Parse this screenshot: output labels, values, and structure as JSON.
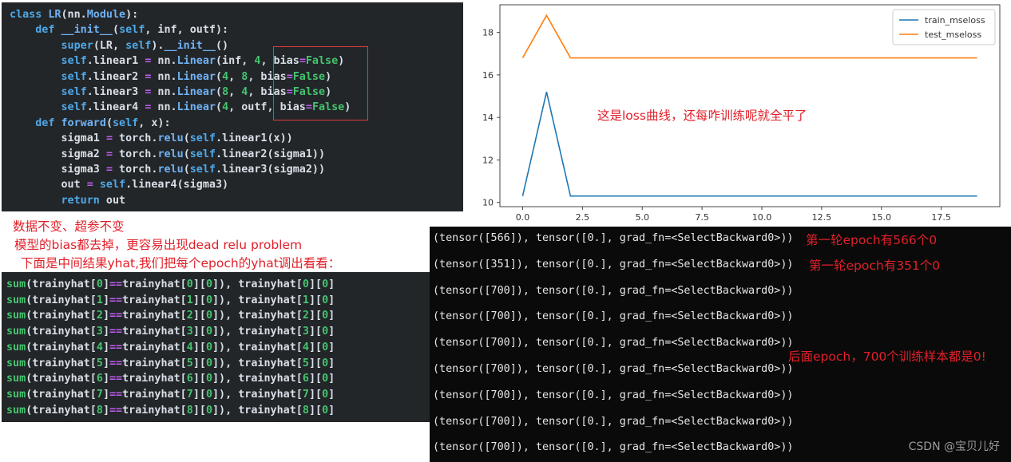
{
  "code": {
    "lines": [
      [
        {
          "t": "class ",
          "c": "kw"
        },
        {
          "t": "LR",
          "c": "fn"
        },
        {
          "t": "(nn.",
          "c": "name"
        },
        {
          "t": "Module",
          "c": "fn"
        },
        {
          "t": "):",
          "c": "name"
        }
      ],
      [
        {
          "t": "    def ",
          "c": "kw"
        },
        {
          "t": "__init__",
          "c": "fn"
        },
        {
          "t": "(",
          "c": "name"
        },
        {
          "t": "self",
          "c": "kw"
        },
        {
          "t": ", inf, outf):",
          "c": "name"
        }
      ],
      [
        {
          "t": "        ",
          "c": "name"
        },
        {
          "t": "super",
          "c": "kw"
        },
        {
          "t": "(LR, ",
          "c": "name"
        },
        {
          "t": "self",
          "c": "kw"
        },
        {
          "t": ").",
          "c": "name"
        },
        {
          "t": "__init__",
          "c": "fn"
        },
        {
          "t": "()",
          "c": "name"
        }
      ],
      [
        {
          "t": "        ",
          "c": "name"
        },
        {
          "t": "self",
          "c": "kw"
        },
        {
          "t": ".linear1 ",
          "c": "name"
        },
        {
          "t": "=",
          "c": "pur"
        },
        {
          "t": " nn.",
          "c": "name"
        },
        {
          "t": "Linear",
          "c": "fn"
        },
        {
          "t": "(inf, ",
          "c": "name"
        },
        {
          "t": "4",
          "c": "grn"
        },
        {
          "t": ", bias",
          "c": "name"
        },
        {
          "t": "=",
          "c": "pur"
        },
        {
          "t": "False",
          "c": "grn"
        },
        {
          "t": ")",
          "c": "name"
        }
      ],
      [
        {
          "t": "        ",
          "c": "name"
        },
        {
          "t": "self",
          "c": "kw"
        },
        {
          "t": ".linear2 ",
          "c": "name"
        },
        {
          "t": "=",
          "c": "pur"
        },
        {
          "t": " nn.",
          "c": "name"
        },
        {
          "t": "Linear",
          "c": "fn"
        },
        {
          "t": "(",
          "c": "name"
        },
        {
          "t": "4",
          "c": "grn"
        },
        {
          "t": ", ",
          "c": "name"
        },
        {
          "t": "8",
          "c": "grn"
        },
        {
          "t": ", bias",
          "c": "name"
        },
        {
          "t": "=",
          "c": "pur"
        },
        {
          "t": "False",
          "c": "grn"
        },
        {
          "t": ")",
          "c": "name"
        }
      ],
      [
        {
          "t": "        ",
          "c": "name"
        },
        {
          "t": "self",
          "c": "kw"
        },
        {
          "t": ".linear3 ",
          "c": "name"
        },
        {
          "t": "=",
          "c": "pur"
        },
        {
          "t": " nn.",
          "c": "name"
        },
        {
          "t": "Linear",
          "c": "fn"
        },
        {
          "t": "(",
          "c": "name"
        },
        {
          "t": "8",
          "c": "grn"
        },
        {
          "t": ", ",
          "c": "name"
        },
        {
          "t": "4",
          "c": "grn"
        },
        {
          "t": ", bias",
          "c": "name"
        },
        {
          "t": "=",
          "c": "pur"
        },
        {
          "t": "False",
          "c": "grn"
        },
        {
          "t": ")",
          "c": "name"
        }
      ],
      [
        {
          "t": "        ",
          "c": "name"
        },
        {
          "t": "self",
          "c": "kw"
        },
        {
          "t": ".linear4 ",
          "c": "name"
        },
        {
          "t": "=",
          "c": "pur"
        },
        {
          "t": " nn.",
          "c": "name"
        },
        {
          "t": "Linear",
          "c": "fn"
        },
        {
          "t": "(",
          "c": "name"
        },
        {
          "t": "4",
          "c": "grn"
        },
        {
          "t": ", outf, bias",
          "c": "name"
        },
        {
          "t": "=",
          "c": "pur"
        },
        {
          "t": "False",
          "c": "grn"
        },
        {
          "t": ")",
          "c": "name"
        }
      ],
      [
        {
          "t": "    def ",
          "c": "kw"
        },
        {
          "t": "forward",
          "c": "fn"
        },
        {
          "t": "(",
          "c": "name"
        },
        {
          "t": "self",
          "c": "kw"
        },
        {
          "t": ", x):",
          "c": "name"
        }
      ],
      [
        {
          "t": "        sigma1 ",
          "c": "name"
        },
        {
          "t": "=",
          "c": "pur"
        },
        {
          "t": " torch.",
          "c": "name"
        },
        {
          "t": "relu",
          "c": "fn"
        },
        {
          "t": "(",
          "c": "name"
        },
        {
          "t": "self",
          "c": "kw"
        },
        {
          "t": ".linear1(x))",
          "c": "name"
        }
      ],
      [
        {
          "t": "        sigma2 ",
          "c": "name"
        },
        {
          "t": "=",
          "c": "pur"
        },
        {
          "t": " torch.",
          "c": "name"
        },
        {
          "t": "relu",
          "c": "fn"
        },
        {
          "t": "(",
          "c": "name"
        },
        {
          "t": "self",
          "c": "kw"
        },
        {
          "t": ".linear2(sigma1))",
          "c": "name"
        }
      ],
      [
        {
          "t": "        sigma3 ",
          "c": "name"
        },
        {
          "t": "=",
          "c": "pur"
        },
        {
          "t": " torch.",
          "c": "name"
        },
        {
          "t": "relu",
          "c": "fn"
        },
        {
          "t": "(",
          "c": "name"
        },
        {
          "t": "self",
          "c": "kw"
        },
        {
          "t": ".linear3(sigma2))",
          "c": "name"
        }
      ],
      [
        {
          "t": "        out ",
          "c": "name"
        },
        {
          "t": "=",
          "c": "pur"
        },
        {
          "t": " ",
          "c": "name"
        },
        {
          "t": "self",
          "c": "kw"
        },
        {
          "t": ".linear4(sigma3)",
          "c": "name"
        }
      ],
      [
        {
          "t": "        ",
          "c": "name"
        },
        {
          "t": "return",
          "c": "kw"
        },
        {
          "t": " out",
          "c": "name"
        }
      ]
    ]
  },
  "annotations": {
    "chart_note": "这是loss曲线，还每咋训练呢就全平了",
    "note1": "数据不变、超参不变",
    "note2": "模型的bias都去掉，更容易出现dead relu problem",
    "note3": "下面是中间结果yhat,我们把每个epoch的yhat调出看看：",
    "epoch1": "第一轮epoch有566个0",
    "epoch2": "第一轮epoch有351个0",
    "later": "后面epoch，700个训练样本都是0!"
  },
  "outputs": {
    "lines": [
      "sum(trainyhat[0]==trainyhat[0][0]), trainyhat[0][0]",
      "sum(trainyhat[1]==trainyhat[1][0]), trainyhat[1][0]",
      "sum(trainyhat[2]==trainyhat[2][0]), trainyhat[2][0]",
      "sum(trainyhat[3]==trainyhat[3][0]), trainyhat[3][0]",
      "sum(trainyhat[4]==trainyhat[4][0]), trainyhat[4][0]",
      "sum(trainyhat[5]==trainyhat[5][0]), trainyhat[5][0]",
      "sum(trainyhat[6]==trainyhat[6][0]), trainyhat[6][0]",
      "sum(trainyhat[7]==trainyhat[7][0]), trainyhat[7][0]",
      "sum(trainyhat[8]==trainyhat[8][0]), trainyhat[8][0]"
    ]
  },
  "tensors": {
    "lines": [
      "(tensor([566]), tensor([0.], grad_fn=<SelectBackward0>))",
      "(tensor([351]), tensor([0.], grad_fn=<SelectBackward0>))",
      "(tensor([700]), tensor([0.], grad_fn=<SelectBackward0>))",
      "(tensor([700]), tensor([0.], grad_fn=<SelectBackward0>))",
      "(tensor([700]), tensor([0.], grad_fn=<SelectBackward0>))",
      "(tensor([700]), tensor([0.], grad_fn=<SelectBackward0>))",
      "(tensor([700]), tensor([0.], grad_fn=<SelectBackward0>))",
      "(tensor([700]), tensor([0.], grad_fn=<SelectBackward0>))",
      "(tensor([700]), tensor([0.], grad_fn=<SelectBackward0>))"
    ]
  },
  "watermark": "CSDN @宝贝儿好",
  "colors": {
    "train": "#1f77b4",
    "test": "#ff7f0e",
    "annotation_red": "#e0202a"
  },
  "chart_data": {
    "type": "line",
    "x": [
      0,
      1,
      2,
      3,
      4,
      5,
      6,
      7,
      8,
      9,
      10,
      11,
      12,
      13,
      14,
      15,
      16,
      17,
      18,
      19
    ],
    "series": [
      {
        "name": "train_mseloss",
        "values": [
          10.3,
          15.2,
          10.3,
          10.3,
          10.3,
          10.3,
          10.3,
          10.3,
          10.3,
          10.3,
          10.3,
          10.3,
          10.3,
          10.3,
          10.3,
          10.3,
          10.3,
          10.3,
          10.3,
          10.3
        ]
      },
      {
        "name": "test_mseloss",
        "values": [
          16.8,
          18.8,
          16.8,
          16.8,
          16.8,
          16.8,
          16.8,
          16.8,
          16.8,
          16.8,
          16.8,
          16.8,
          16.8,
          16.8,
          16.8,
          16.8,
          16.8,
          16.8,
          16.8,
          16.8
        ]
      }
    ],
    "xticks": [
      "0.0",
      "2.5",
      "5.0",
      "7.5",
      "10.0",
      "12.5",
      "15.0",
      "17.5"
    ],
    "xtick_values": [
      0,
      2.5,
      5,
      7.5,
      10,
      12.5,
      15,
      17.5
    ],
    "yticks": [
      "10",
      "12",
      "14",
      "16",
      "18"
    ],
    "ytick_values": [
      10,
      12,
      14,
      16,
      18
    ],
    "xlim": [
      -0.95,
      19.95
    ],
    "ylim": [
      9.8,
      19.3
    ],
    "legend": "top-right",
    "grid": false
  }
}
